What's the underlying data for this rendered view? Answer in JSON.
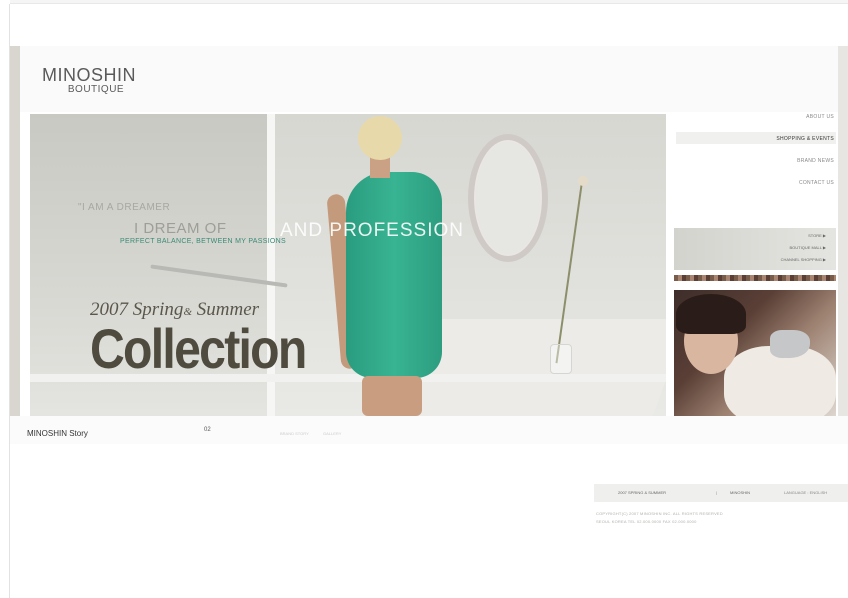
{
  "brand": {
    "name": "MINOSHIN",
    "sub": "BOUTIQUE"
  },
  "nav": {
    "items": [
      {
        "label": "ABOUT US"
      },
      {
        "label": "SHOPPING & EVENTS"
      },
      {
        "label": "BRAND NEWS"
      },
      {
        "label": "CONTACT US"
      }
    ],
    "sub_items": [
      {
        "label": "STORE ▶"
      },
      {
        "label": "BOUTIQUE MALL ▶"
      },
      {
        "label": "CHANNEL SHOPPING ▶"
      }
    ]
  },
  "hero": {
    "quote_small": "\"I AM A DREAMER",
    "quote_big": "I DREAM OF",
    "quote_big_2": "AND PROFESSION",
    "quote_tag": "PERFECT BALANCE, BETWEEN MY PASSIONS",
    "season_year": "2007",
    "season_a": "Spring",
    "season_amp": "&",
    "season_b": "Summer",
    "collection": "Collection"
  },
  "story": {
    "label": "MINOSHIN Story",
    "page": "02",
    "thumbs": [
      "",
      "",
      "BRAND STORY",
      "GALLERY"
    ]
  },
  "footer": {
    "bar": [
      "2007 SPRING & SUMMER",
      "|",
      "MINOSHIN",
      "LANGUAGE : ENGLISH"
    ],
    "copy_1": "COPYRIGHT(C) 2007 MINOSHIN INC. ALL RIGHTS RESERVED",
    "copy_2": "SEOUL KOREA TEL 02.000.0000 FAX 02.000.0000"
  },
  "colors": {
    "accent": "#38b492",
    "headline": "#4f4b3f",
    "panel": "#d7d7d2"
  }
}
